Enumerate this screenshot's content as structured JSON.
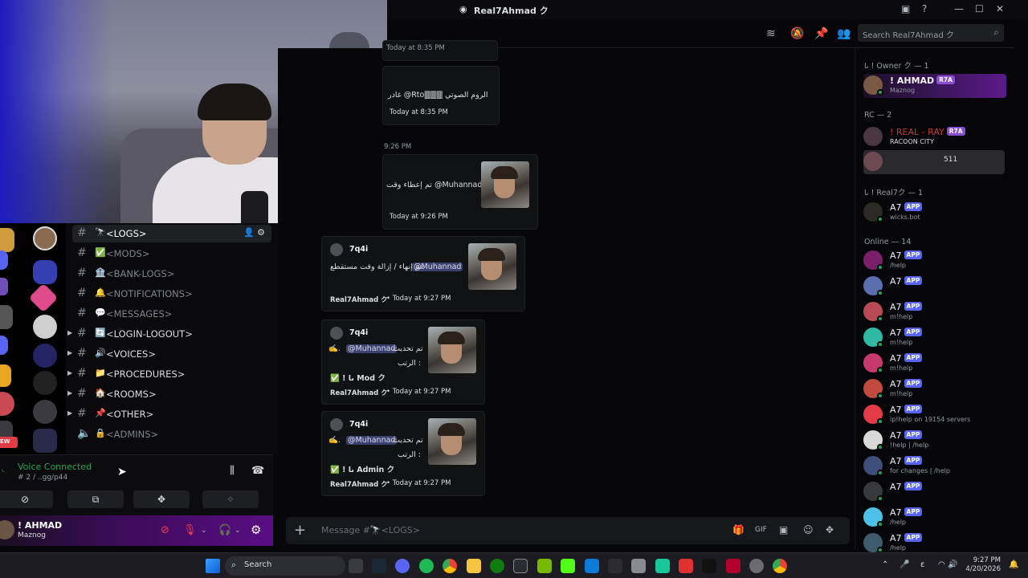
{
  "window": {
    "title": "Real7Ahmad ク",
    "controls": {
      "inbox": "▣",
      "help": "?",
      "minimize": "—",
      "maximize": "☐",
      "close": "✕"
    }
  },
  "header": {
    "search_placeholder": "Search Real7Ahmad ク",
    "icons": [
      "threads-icon",
      "mute-icon",
      "pin-icon",
      "members-icon"
    ]
  },
  "channels": [
    {
      "name": "<LOGS>",
      "emoji": "🔭",
      "active": true,
      "bright": true,
      "caret": false
    },
    {
      "name": "<MODS>",
      "emoji": "✅",
      "active": false,
      "bright": false,
      "caret": false
    },
    {
      "name": "<BANK-LOGS>",
      "emoji": "🏦",
      "active": false,
      "bright": false,
      "caret": false
    },
    {
      "name": "<NOTIFICATIONS>",
      "emoji": "🔔",
      "active": false,
      "bright": false,
      "caret": false
    },
    {
      "name": "<MESSAGES>",
      "emoji": "💬",
      "active": false,
      "bright": false,
      "caret": false
    },
    {
      "name": "<LOGIN-LOGOUT>",
      "emoji": "🔄",
      "active": false,
      "bright": true,
      "caret": true
    },
    {
      "name": "<VOICES>",
      "emoji": "🔊",
      "active": false,
      "bright": true,
      "caret": true
    },
    {
      "name": "<PROCEDURES>",
      "emoji": "📁",
      "active": false,
      "bright": true,
      "caret": true
    },
    {
      "name": "<ROOMS>",
      "emoji": "🏠",
      "active": false,
      "bright": true,
      "caret": true
    },
    {
      "name": "<OTHER>",
      "emoji": "📌",
      "active": false,
      "bright": true,
      "caret": true
    },
    {
      "name": "<ADMINS>",
      "emoji": "🔒",
      "active": false,
      "bright": false,
      "caret": false
    }
  ],
  "voice": {
    "status": "Voice Connected",
    "sub": "# 2 / ..gg/p44"
  },
  "user": {
    "name": "! AHMAD",
    "status": "Maznog"
  },
  "messages": {
    "partial_time_top": "Today at 8:35 PM",
    "m1_text": "غادر @Rto🀫🀫🀫 الروم الصوتي",
    "m1_time": "Today at 8:35 PM",
    "divider_time": "9:26 PM",
    "m2_text": "تم إعطاء وقت @Muhannad",
    "m2_time": "Today at 9:26 PM",
    "m3_author": "7q4i",
    "m3_text_mention": "@Muhannad",
    "m3_text": "تم إنهاء / إزالة وقت مستقطع.",
    "m3_footer_name": "Real7Ahmad ク",
    "m3_footer_time": "• Today at 9:27 PM",
    "m4_author": "7q4i",
    "m4_line1": "تم تحديث",
    "m4_mention": "@Muhannad",
    "m4_line2": "الرتب :",
    "m4_role": "✅ ! ىا Mod ク",
    "m4_footer_name": "Real7Ahmad ク",
    "m4_footer_time": "• Today at 9:27 PM",
    "m5_author": "7q4i",
    "m5_line1": "تم تحديث",
    "m5_mention": "@Muhannad",
    "m5_line2": "الرتب :",
    "m5_role": "✅ ! ىا Admin ク",
    "m5_footer_name": "Real7Ahmad ク",
    "m5_footer_time": "• Today at 9:27 PM"
  },
  "composer": {
    "placeholder": "Message #🔭<LOGS>"
  },
  "members": {
    "owner_header": "ىا ! Owner ク — 1",
    "owner": {
      "name": "! AHMAD",
      "tag": "R7A",
      "sub": "Maznog"
    },
    "rc_header": "RC — 2",
    "rc": [
      {
        "name": "! REAL - RAY",
        "tag": "R7A",
        "sub": "RACOON CITY"
      },
      {
        "name": "",
        "tag": "511",
        "sub": ""
      }
    ],
    "real_header": "ىا ! Real7ク — 1",
    "real": [
      {
        "name": "A7",
        "badge": "APP",
        "sub": "wicks.bot",
        "color": "#2b2a24"
      }
    ],
    "online_header": "Online — 14",
    "online": [
      {
        "name": "A7",
        "badge": "APP",
        "sub": "/help",
        "color": "#7a1f6a"
      },
      {
        "name": "A7",
        "badge": "APP",
        "sub": "",
        "color": "#5b6fb0"
      },
      {
        "name": "A7",
        "badge": "APP",
        "sub": "m!help",
        "color": "#b84a55"
      },
      {
        "name": "A7",
        "badge": "APP",
        "sub": "m!help",
        "color": "#2fb9a5"
      },
      {
        "name": "A7",
        "badge": "APP",
        "sub": "m!help",
        "color": "#c53a6b"
      },
      {
        "name": "A7",
        "badge": "APP",
        "sub": "m!help",
        "color": "#c2493d"
      },
      {
        "name": "A7",
        "badge": "APP",
        "sub": "ip!help on 19154 servers",
        "color": "#e23b46"
      },
      {
        "name": "A7",
        "badge": "APP",
        "sub": "!help | /help",
        "color": "#d9d9d9"
      },
      {
        "name": "A7",
        "badge": "APP",
        "sub": "for changes | /help",
        "color": "#3d4e7a"
      },
      {
        "name": "A7",
        "badge": "APP",
        "sub": "",
        "color": "#38393d"
      },
      {
        "name": "A7",
        "badge": "APP",
        "sub": "/help",
        "color": "#4cc1e5"
      },
      {
        "name": "A7",
        "badge": "APP",
        "sub": "/help",
        "color": "#3e5b6d"
      }
    ]
  },
  "taskbar": {
    "search": "Search",
    "time": "9:27 PM",
    "date": "4/20/2026",
    "lang": "ε"
  },
  "colors": {
    "accent": "#5865f2",
    "online": "#23a55a",
    "mention_bg": "#3c4270",
    "danger": "#f23f43"
  }
}
